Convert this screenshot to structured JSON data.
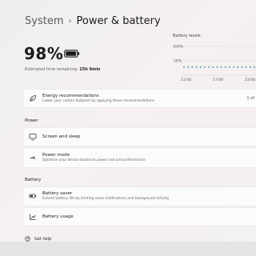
{
  "breadcrumb": {
    "parent": "System",
    "separator": "›",
    "current": "Power & battery"
  },
  "battery": {
    "percent": "98%",
    "level": 0.98,
    "estimate_label": "Estimated time remaining:",
    "estimate_value": "15h 9min"
  },
  "chart": {
    "title": "Battery levels",
    "y_ticks": [
      "100%",
      "50%"
    ],
    "x_ticks": [
      "11:00",
      "17:00",
      "23:00"
    ]
  },
  "chart_data": {
    "type": "scatter",
    "title": "Battery levels",
    "ylim": [
      0,
      100
    ],
    "y_ticks": [
      "100%",
      "50%"
    ],
    "x_ticks": [
      "11:00",
      "17:00",
      "23:00"
    ],
    "series": [
      {
        "values": [
          28,
          28,
          28,
          28,
          28,
          28,
          28,
          28,
          28,
          28,
          28,
          28,
          28,
          28,
          28,
          28,
          28,
          28
        ]
      }
    ],
    "grid": true,
    "colors": {
      "points": "#1f8fbf",
      "grid": "#d6d6d6"
    }
  },
  "energy_card": {
    "icon": "leaf-icon",
    "title": "Energy recommendations",
    "description": "Lower your carbon footprint by applying these recommendations",
    "trailing": "1 of"
  },
  "power_section": {
    "label": "Power",
    "items": [
      {
        "icon": "screen-sleep-icon",
        "title": "Screen and sleep"
      },
      {
        "icon": "power-mode-icon",
        "title": "Power mode",
        "description": "Optimize your device based on power use and performance"
      }
    ]
  },
  "battery_section": {
    "label": "Battery",
    "items": [
      {
        "icon": "battery-saver-icon",
        "title": "Battery saver",
        "description": "Extend battery life by limiting some notifications and background activity"
      },
      {
        "icon": "battery-usage-icon",
        "title": "Battery usage"
      }
    ]
  },
  "help": {
    "icon": "help-icon",
    "label": "Get help"
  }
}
